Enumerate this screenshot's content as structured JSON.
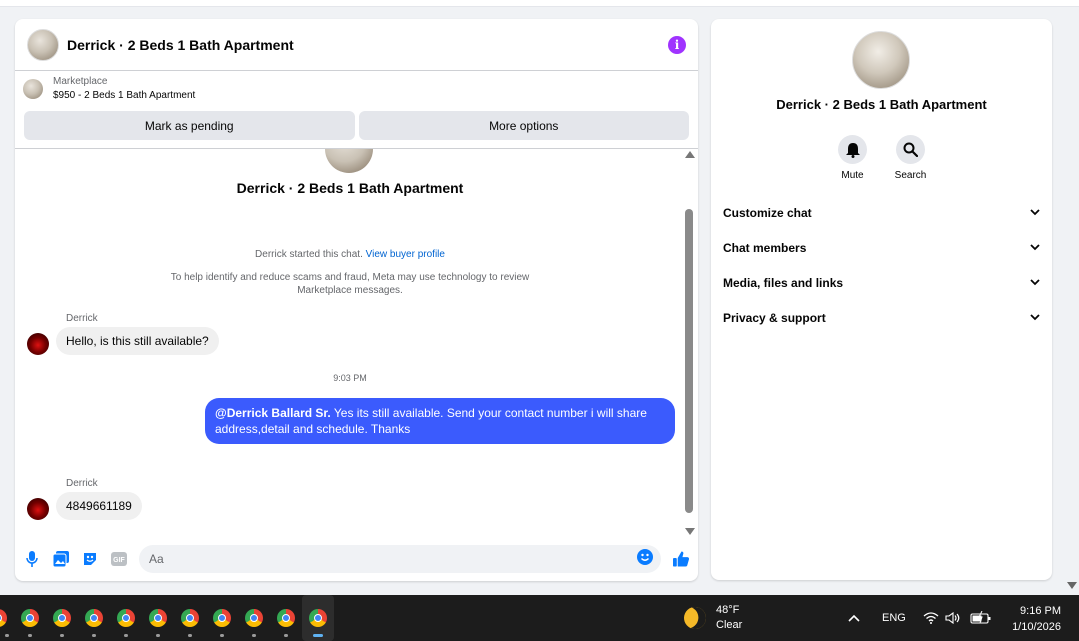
{
  "chat": {
    "title": "Derrick · 2 Beds 1 Bath Apartment",
    "listing_source": "Marketplace",
    "listing_title": "$950 - 2 Beds 1 Bath Apartment",
    "mark_pending_label": "Mark as pending",
    "more_options_label": "More options",
    "hero_title": "Derrick · 2 Beds 1 Bath Apartment",
    "started_text": "Derrick started this chat.",
    "view_profile_link": "View buyer profile",
    "scam_notice_line1": "To help identify and reduce scams and fraud, Meta may use technology to review",
    "scam_notice_line2": "Marketplace messages.",
    "messages": [
      {
        "sender": "Derrick",
        "text": "Hello, is this still available?"
      },
      {
        "time": "9:03 PM"
      },
      {
        "mention": "@Derrick Ballard Sr.",
        "text_line1": " Yes its still available. Send your contact number i will share",
        "text_line2": "address,detail and schedule. Thanks"
      },
      {
        "sender": "Derrick",
        "text": "4849661189"
      }
    ],
    "composer_placeholder": "Aa",
    "gif_label": "GIF"
  },
  "info": {
    "title": "Derrick · 2 Beds 1 Bath Apartment",
    "mute_label": "Mute",
    "search_label": "Search",
    "sections": [
      "Customize chat",
      "Chat members",
      "Media, files and links",
      "Privacy & support"
    ]
  },
  "taskbar": {
    "weather_temp": "48°F",
    "weather_desc": "Clear",
    "language": "ENG",
    "time": "9:16 PM",
    "date": "1/10/2026"
  },
  "colors": {
    "messenger_blue": "#3b5bfd",
    "info_purple": "#a033ff",
    "link_blue": "#0064d1",
    "icon_blue": "#0a7cff"
  }
}
